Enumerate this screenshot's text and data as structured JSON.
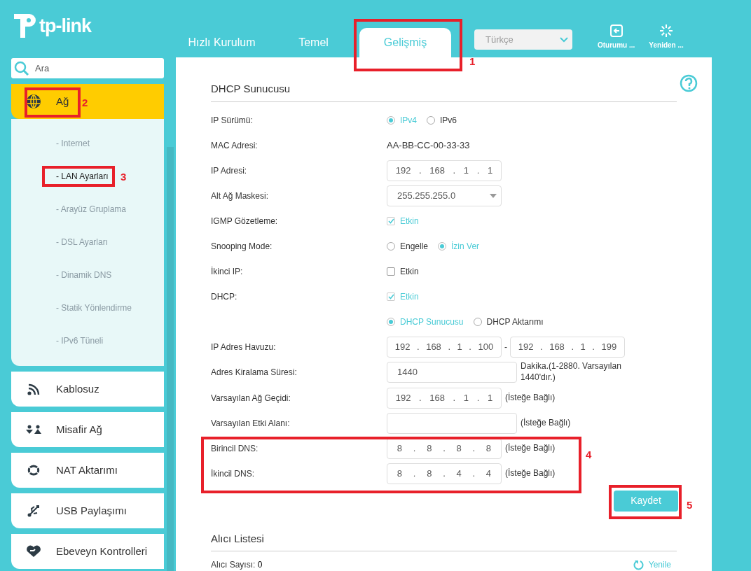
{
  "logo": {
    "text": "tp-link"
  },
  "tabs": [
    {
      "label": "Hızlı Kurulum",
      "selected": false
    },
    {
      "label": "Temel",
      "selected": false
    },
    {
      "label": "Gelişmiş",
      "selected": true
    }
  ],
  "language": {
    "value": "Türkçe"
  },
  "header_buttons": [
    {
      "label": "Oturumu ...",
      "kind": "logout"
    },
    {
      "label": "Yeniden ...",
      "kind": "reboot"
    }
  ],
  "search": {
    "placeholder": "Ara"
  },
  "sidebar": {
    "items": [
      {
        "label": "Ağ",
        "kind": "globe",
        "expanded": true,
        "children": [
          {
            "label": "- Internet",
            "selected": false
          },
          {
            "label": "- LAN Ayarları",
            "selected": true
          },
          {
            "label": "- Arayüz Gruplama",
            "selected": false
          },
          {
            "label": "- DSL Ayarları",
            "selected": false
          },
          {
            "label": "- Dinamik DNS",
            "selected": false
          },
          {
            "label": "- Statik Yönlendirme",
            "selected": false
          },
          {
            "label": "- IPv6 Tüneli",
            "selected": false
          }
        ]
      },
      {
        "label": "Kablosuz",
        "kind": "wifi",
        "expanded": false
      },
      {
        "label": "Misafir Ağ",
        "kind": "guests",
        "expanded": false
      },
      {
        "label": "NAT Aktarımı",
        "kind": "nat",
        "expanded": false
      },
      {
        "label": "USB Paylaşımı",
        "kind": "usb",
        "expanded": false
      },
      {
        "label": "Ebeveyn Kontrolleri",
        "kind": "heart",
        "expanded": false
      }
    ]
  },
  "ip_separator": ".",
  "dhcp": {
    "title": "DHCP Sunucusu",
    "rows": [
      {
        "label": "IP Sürümü:",
        "kind": "radio",
        "options": [
          {
            "label": "IPv4",
            "selected": true
          },
          {
            "label": "IPv6",
            "selected": false
          }
        ]
      },
      {
        "label": "MAC Adresi:",
        "kind": "text",
        "value": "AA-BB-CC-00-33-33"
      },
      {
        "label": "IP Adresi:",
        "kind": "ip",
        "octets": [
          "192",
          "168",
          "1",
          "1"
        ]
      },
      {
        "label": "Alt Ağ Maskesi:",
        "kind": "select",
        "value": "255.255.255.0"
      },
      {
        "label": "IGMP Gözetleme:",
        "kind": "checkbox",
        "text": "Etkin",
        "checked": true
      },
      {
        "label": "Snooping Mode:",
        "kind": "radio",
        "options": [
          {
            "label": "Engelle",
            "selected": false
          },
          {
            "label": "İzin Ver",
            "selected": true
          }
        ]
      },
      {
        "label": "İkinci IP:",
        "kind": "checkbox",
        "text": "Etkin",
        "checked": false
      },
      {
        "label": "DHCP:",
        "kind": "checkbox",
        "text": "Etkin",
        "checked": true
      },
      {
        "kind": "radio",
        "options": [
          {
            "label": "DHCP Sunucusu",
            "selected": true
          },
          {
            "label": "DHCP Aktarımı",
            "selected": false
          }
        ]
      },
      {
        "label": "IP Adres Havuzu:",
        "kind": "ip_range",
        "octets": [
          "192",
          "168",
          "1",
          "100"
        ],
        "range_separator": "-",
        "octets_end": [
          "192",
          "168",
          "1",
          "199"
        ]
      },
      {
        "label": "Adres Kiralama Süresi:",
        "kind": "input",
        "value": "1440",
        "note": "Dakika.(1-2880. Varsayılan 1440'dır.)"
      },
      {
        "label": "Varsayılan Ağ Geçidi:",
        "kind": "ip",
        "octets": [
          "192",
          "168",
          "1",
          "1"
        ],
        "note": "(İsteğe Bağlı)"
      },
      {
        "label": "Varsayılan Etki Alanı:",
        "kind": "input",
        "note": "(İsteğe Bağlı)"
      },
      {
        "label": "Birincil DNS:",
        "kind": "ip",
        "octets": [
          "8",
          "8",
          "8",
          "8"
        ],
        "note": "(İsteğe Bağlı)"
      },
      {
        "label": "İkincil DNS:",
        "kind": "ip",
        "octets": [
          "8",
          "8",
          "4",
          "4"
        ],
        "note": "(İsteğe Bağlı)"
      }
    ],
    "save_button": "Kaydet"
  },
  "clients": {
    "title": "Alıcı Listesi",
    "count_label": "Alıcı Sayısı:",
    "count": "0",
    "refresh": "Yenile"
  },
  "annotations": [
    {
      "label": "1"
    },
    {
      "label": "2"
    },
    {
      "label": "3"
    },
    {
      "label": "4"
    },
    {
      "label": "5"
    }
  ]
}
